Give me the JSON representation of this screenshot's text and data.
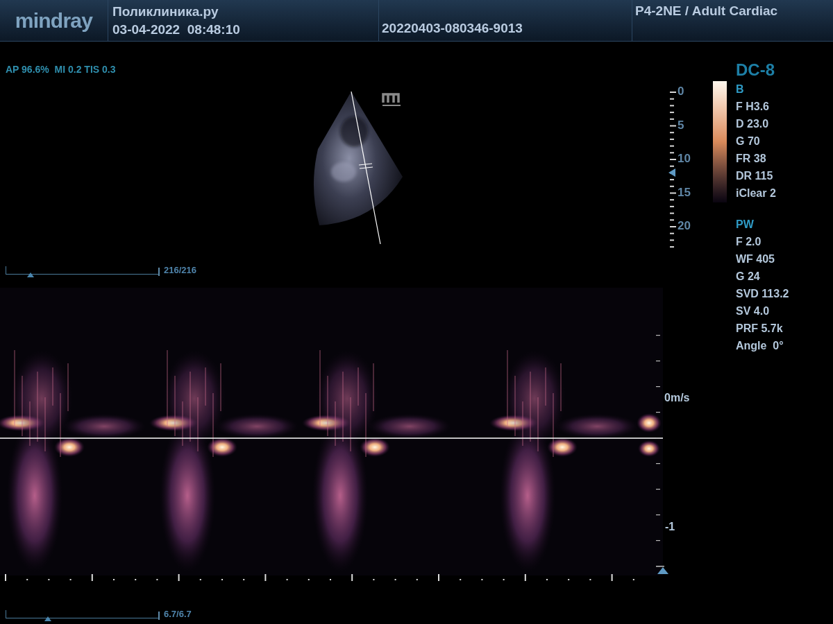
{
  "header": {
    "logo": "mindray",
    "clinic": "Поликлиника.ру",
    "datetime": "03-04-2022  08:48:10",
    "exam_id": "20220403-080346-9013",
    "probe_preset": "P4-2NE / Adult Cardiac"
  },
  "acoustic_output": "AP 96.6%  MI 0.2 TIS 0.3",
  "mode_title": "DC-8",
  "depth_scale": {
    "labels": [
      "0",
      "5",
      "10",
      "15",
      "20"
    ]
  },
  "parameters": [
    {
      "title": "B",
      "items": [
        "F H3.6",
        "D 23.0",
        "G 70",
        "FR 38",
        "DR 115",
        "iClear 2"
      ]
    },
    {
      "title": "PW",
      "items": [
        "F 2.0",
        "WF 405",
        "G 24",
        "SVD 113.2",
        "SV 4.0",
        "PRF 5.7k",
        "Angle  0°"
      ]
    }
  ],
  "cine_slider": {
    "level": 0.14,
    "reading": "216/216"
  },
  "doppler_scale": {
    "baseline_label": "0m/s",
    "lower_label": "-1"
  },
  "time_slider": {
    "level": 0.26,
    "reading": "6.7/6.7"
  }
}
